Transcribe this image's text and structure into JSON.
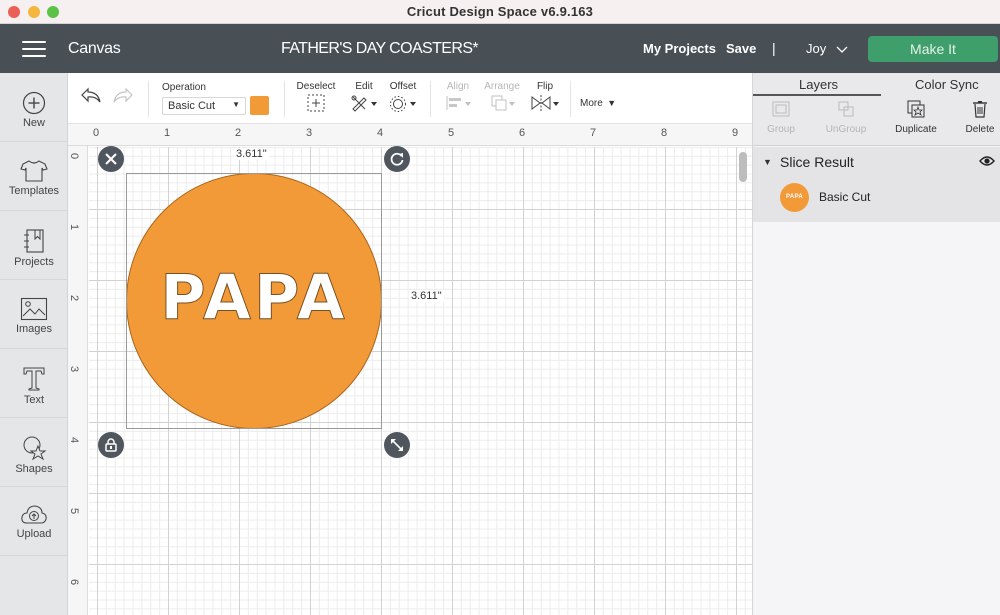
{
  "window": {
    "title": "Cricut Design Space  v6.9.163"
  },
  "header": {
    "section": "Canvas",
    "project_title": "FATHER'S DAY COASTERS*",
    "my_projects": "My Projects",
    "save": "Save",
    "separator": "|",
    "user": "Joy",
    "make_it": "Make It",
    "make_it_color": "#3e9e6c"
  },
  "sidebar": {
    "items": [
      {
        "label": "New",
        "icon": "plus-circle-icon"
      },
      {
        "label": "Templates",
        "icon": "tshirt-icon"
      },
      {
        "label": "Projects",
        "icon": "notebook-icon"
      },
      {
        "label": "Images",
        "icon": "image-icon"
      },
      {
        "label": "Text",
        "icon": "text-t-icon"
      },
      {
        "label": "Shapes",
        "icon": "shapes-icon"
      },
      {
        "label": "Upload",
        "icon": "cloud-upload-icon"
      }
    ]
  },
  "toolbar": {
    "undo_icon": "undo-icon",
    "redo_icon": "redo-icon",
    "operation_label": "Operation",
    "operation_value": "Basic Cut",
    "operation_color": "#f29a38",
    "deselect": "Deselect",
    "edit": "Edit",
    "offset": "Offset",
    "align": "Align",
    "arrange": "Arrange",
    "flip": "Flip",
    "more": "More"
  },
  "canvas": {
    "ruler_x": [
      "0",
      "1",
      "2",
      "3",
      "4",
      "5",
      "6",
      "7",
      "8",
      "9"
    ],
    "ruler_y": [
      "0",
      "1",
      "2",
      "3",
      "4",
      "5",
      "6"
    ],
    "width_readout": "3.611\"",
    "height_readout": "3.611\"",
    "shape_text": "PAPA",
    "shape_color": "#f29a38"
  },
  "panel": {
    "tabs": [
      "Layers",
      "Color Sync"
    ],
    "active_tab": "Layers",
    "actions": [
      {
        "label": "Group",
        "enabled": false
      },
      {
        "label": "UnGroup",
        "enabled": false
      },
      {
        "label": "Duplicate",
        "enabled": true
      },
      {
        "label": "Delete",
        "enabled": true
      }
    ],
    "layer_group": {
      "title": "Slice Result",
      "items": [
        {
          "name": "Basic Cut",
          "thumb_text": "PAPA",
          "color": "#f29a38"
        }
      ]
    }
  }
}
